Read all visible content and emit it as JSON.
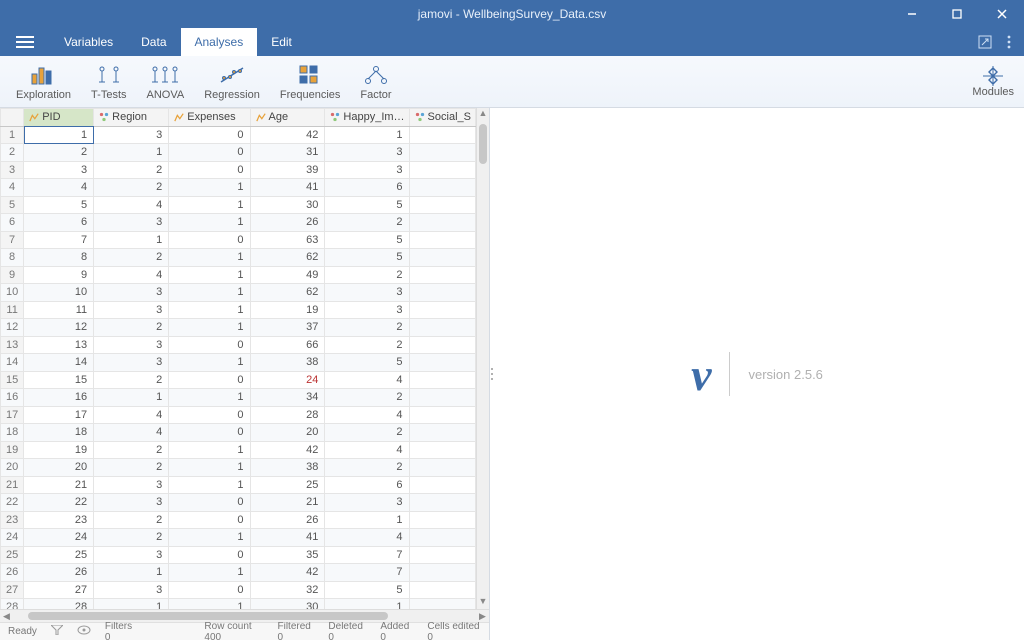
{
  "window": {
    "title": "jamovi - WellbeingSurvey_Data.csv"
  },
  "menu": {
    "tabs": [
      "Variables",
      "Data",
      "Analyses",
      "Edit"
    ],
    "active": 2
  },
  "ribbon": {
    "items": [
      "Exploration",
      "T-Tests",
      "ANOVA",
      "Regression",
      "Frequencies",
      "Factor"
    ],
    "modules_label": "Modules"
  },
  "columns": [
    {
      "name": "PID",
      "type": "cont",
      "selected": true
    },
    {
      "name": "Region",
      "type": "nom"
    },
    {
      "name": "Expenses",
      "type": "cont"
    },
    {
      "name": "Age",
      "type": "cont"
    },
    {
      "name": "Happy_Im…",
      "type": "nom"
    },
    {
      "name": "Social_S",
      "type": "nom"
    }
  ],
  "rows": [
    {
      "n": 1,
      "PID": 1,
      "Region": 3,
      "Expenses": 0,
      "Age": 42,
      "Happy": 1
    },
    {
      "n": 2,
      "PID": 2,
      "Region": 1,
      "Expenses": 0,
      "Age": 31,
      "Happy": 3
    },
    {
      "n": 3,
      "PID": 3,
      "Region": 2,
      "Expenses": 0,
      "Age": 39,
      "Happy": 3
    },
    {
      "n": 4,
      "PID": 4,
      "Region": 2,
      "Expenses": 1,
      "Age": 41,
      "Happy": 6
    },
    {
      "n": 5,
      "PID": 5,
      "Region": 4,
      "Expenses": 1,
      "Age": 30,
      "Happy": 5
    },
    {
      "n": 6,
      "PID": 6,
      "Region": 3,
      "Expenses": 1,
      "Age": 26,
      "Happy": 2
    },
    {
      "n": 7,
      "PID": 7,
      "Region": 1,
      "Expenses": 0,
      "Age": 63,
      "Happy": 5
    },
    {
      "n": 8,
      "PID": 8,
      "Region": 2,
      "Expenses": 1,
      "Age": 62,
      "Happy": 5
    },
    {
      "n": 9,
      "PID": 9,
      "Region": 4,
      "Expenses": 1,
      "Age": 49,
      "Happy": 2
    },
    {
      "n": 10,
      "PID": 10,
      "Region": 3,
      "Expenses": 1,
      "Age": 62,
      "Happy": 3
    },
    {
      "n": 11,
      "PID": 11,
      "Region": 3,
      "Expenses": 1,
      "Age": 19,
      "Happy": 3
    },
    {
      "n": 12,
      "PID": 12,
      "Region": 2,
      "Expenses": 1,
      "Age": 37,
      "Happy": 2
    },
    {
      "n": 13,
      "PID": 13,
      "Region": 3,
      "Expenses": 0,
      "Age": 66,
      "Happy": 2
    },
    {
      "n": 14,
      "PID": 14,
      "Region": 3,
      "Expenses": 1,
      "Age": 38,
      "Happy": 5
    },
    {
      "n": 15,
      "PID": 15,
      "Region": 2,
      "Expenses": 0,
      "Age": 24,
      "Happy": 4,
      "age_red": true
    },
    {
      "n": 16,
      "PID": 16,
      "Region": 1,
      "Expenses": 1,
      "Age": 34,
      "Happy": 2
    },
    {
      "n": 17,
      "PID": 17,
      "Region": 4,
      "Expenses": 0,
      "Age": 28,
      "Happy": 4
    },
    {
      "n": 18,
      "PID": 18,
      "Region": 4,
      "Expenses": 0,
      "Age": 20,
      "Happy": 2
    },
    {
      "n": 19,
      "PID": 19,
      "Region": 2,
      "Expenses": 1,
      "Age": 42,
      "Happy": 4
    },
    {
      "n": 20,
      "PID": 20,
      "Region": 2,
      "Expenses": 1,
      "Age": 38,
      "Happy": 2
    },
    {
      "n": 21,
      "PID": 21,
      "Region": 3,
      "Expenses": 1,
      "Age": 25,
      "Happy": 6
    },
    {
      "n": 22,
      "PID": 22,
      "Region": 3,
      "Expenses": 0,
      "Age": 21,
      "Happy": 3
    },
    {
      "n": 23,
      "PID": 23,
      "Region": 2,
      "Expenses": 0,
      "Age": 26,
      "Happy": 1
    },
    {
      "n": 24,
      "PID": 24,
      "Region": 2,
      "Expenses": 1,
      "Age": 41,
      "Happy": 4
    },
    {
      "n": 25,
      "PID": 25,
      "Region": 3,
      "Expenses": 0,
      "Age": 35,
      "Happy": 7
    },
    {
      "n": 26,
      "PID": 26,
      "Region": 1,
      "Expenses": 1,
      "Age": 42,
      "Happy": 7
    },
    {
      "n": 27,
      "PID": 27,
      "Region": 3,
      "Expenses": 0,
      "Age": 32,
      "Happy": 5
    },
    {
      "n": 28,
      "PID": 28,
      "Region": 1,
      "Expenses": 1,
      "Age": 30,
      "Happy": 1
    }
  ],
  "status": {
    "ready": "Ready",
    "filters": "Filters 0",
    "row_count": "Row count 400",
    "filtered": "Filtered 0",
    "deleted": "Deleted 0",
    "added": "Added 0",
    "cells_edited": "Cells edited 0"
  },
  "splash": {
    "version_label": "version 2.5.6"
  }
}
